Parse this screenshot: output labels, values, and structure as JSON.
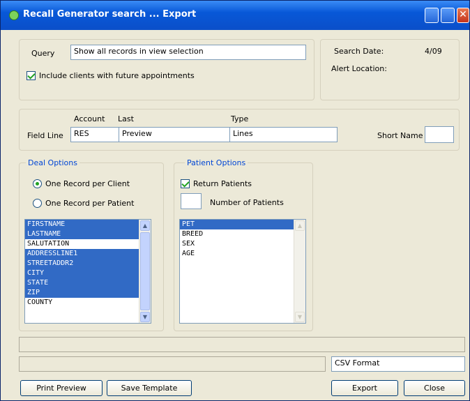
{
  "window": {
    "title": "Recall Generator search ... Export",
    "min_glyph": "",
    "max_glyph": "",
    "close_glyph": "✕"
  },
  "query": {
    "label": "Query",
    "value": "Show all records in view selection",
    "include_label": "Include clients with future appointments",
    "include_checked": true
  },
  "info": {
    "date_label": "Search Date:",
    "date_value": "4/09",
    "location_label": "Alert Location:"
  },
  "fields": {
    "account_label": "Account",
    "first_label": "Last",
    "last_label": "Type",
    "row_label": "Field Line",
    "account_value": "RES",
    "first_value": "Preview",
    "last_value": "Lines",
    "short_label": "Short Name",
    "short_value": ""
  },
  "deal_group": {
    "title": "Deal Options",
    "option1": "One Record per Client",
    "option2": "One Record per Patient",
    "selected": 0,
    "list": [
      {
        "text": "FIRSTNAME",
        "selected": true
      },
      {
        "text": "LASTNAME",
        "selected": true
      },
      {
        "text": "SALUTATION",
        "selected": false
      },
      {
        "text": "ADDRESSLINE1",
        "selected": true
      },
      {
        "text": "STREETADDR2",
        "selected": true
      },
      {
        "text": "CITY",
        "selected": true
      },
      {
        "text": "STATE",
        "selected": true
      },
      {
        "text": "ZIP",
        "selected": true
      },
      {
        "text": "COUNTY",
        "selected": false
      }
    ]
  },
  "patient_group": {
    "title": "Patient Options",
    "return_label": "Return Patients",
    "return_checked": true,
    "number_label": "Number of Patients",
    "number_value": "",
    "list": [
      {
        "text": "PET",
        "selected": true
      },
      {
        "text": "BREED",
        "selected": false
      },
      {
        "text": "SEX",
        "selected": false
      },
      {
        "text": "AGE",
        "selected": false
      }
    ]
  },
  "footer": {
    "format_value": "CSV Format",
    "preview_button": "Print Preview",
    "template_button": "Save Template",
    "export_button": "Export",
    "close_button": "Close"
  }
}
